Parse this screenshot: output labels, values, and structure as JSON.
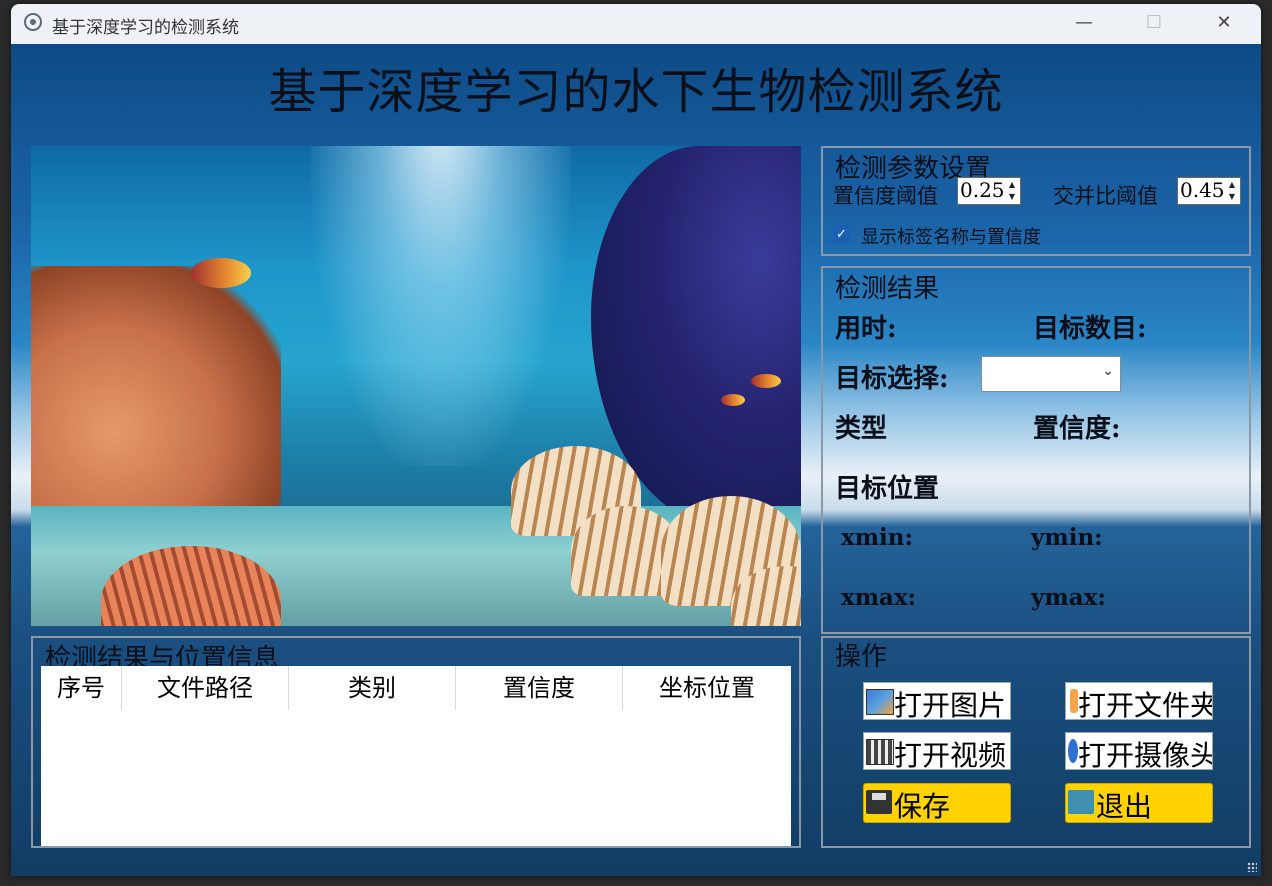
{
  "window": {
    "title": "基于深度学习的检测系统",
    "minimize_glyph": "—",
    "maximize_glyph": "☐",
    "close_glyph": "✕"
  },
  "main": {
    "title": "基于深度学习的水下生物检测系统"
  },
  "params": {
    "group_title": "检测参数设置",
    "confidence_label": "置信度阈值",
    "confidence_value": "0.25",
    "iou_label": "交并比阈值",
    "iou_value": "0.45",
    "show_labels_text": "显示标签名称与置信度",
    "show_labels_checked": true
  },
  "results": {
    "group_title": "检测结果",
    "time_label": "用时:",
    "count_label": "目标数目:",
    "target_select_label": "目标选择:",
    "target_select_value": "",
    "type_label": "类型",
    "confidence_label": "置信度:",
    "position_label": "目标位置",
    "xmin_label": "xmin:",
    "ymin_label": "ymin:",
    "xmax_label": "xmax:",
    "ymax_label": "ymax:"
  },
  "operations": {
    "group_title": "操作",
    "open_image": "打开图片",
    "open_file": "打开文件夹",
    "open_video": "打开视频",
    "open_camera": "打开摄像头",
    "save": "保存",
    "exit": "退出"
  },
  "table": {
    "group_title": "检测结果与位置信息",
    "columns": [
      "序号",
      "文件路径",
      "类别",
      "置信度",
      "坐标位置"
    ],
    "rows": []
  },
  "icons": {
    "app": "app-logo-icon",
    "open_image": "image-icon",
    "open_file": "folder-icon",
    "open_video": "video-icon",
    "open_camera": "camera-icon",
    "save": "save-icon",
    "exit": "exit-icon"
  },
  "colors": {
    "button_yellow": "#ffd200",
    "checkbox_blue": "#1a5fb4"
  }
}
